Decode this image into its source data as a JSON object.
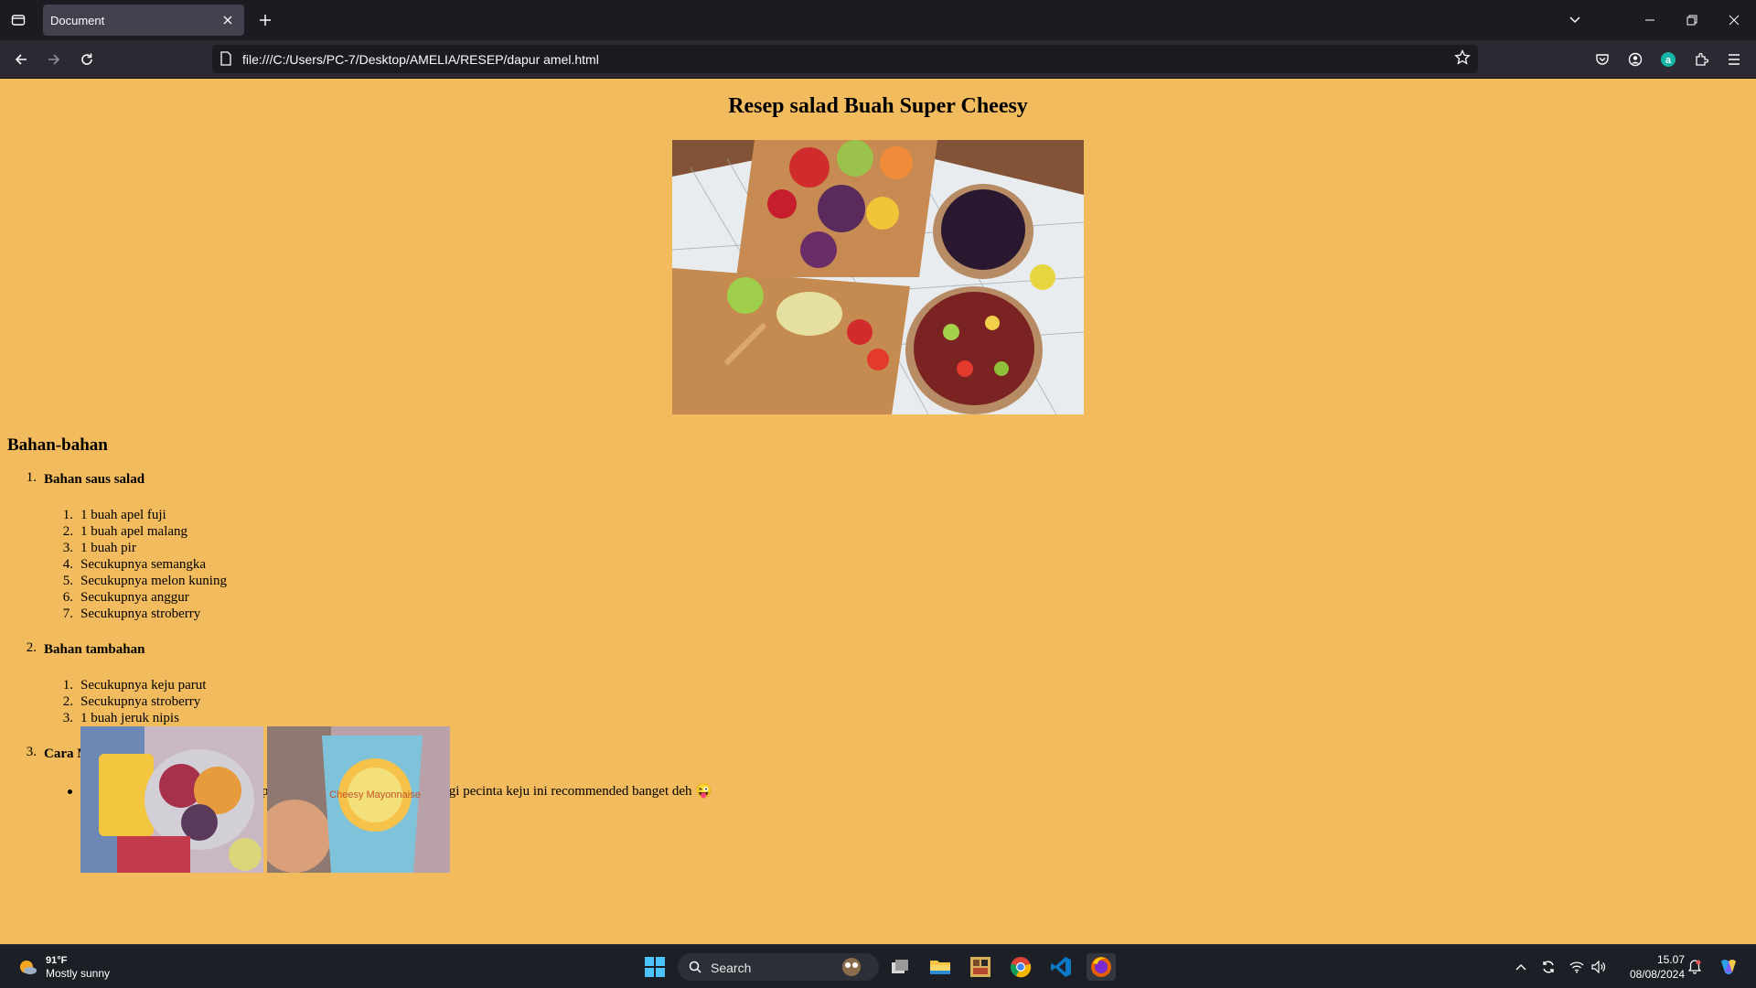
{
  "browser": {
    "tab_title": "Document",
    "url": "file:///C:/Users/PC-7/Desktop/AMELIA/RESEP/dapur amel.html"
  },
  "page": {
    "title": "Resep salad Buah Super Cheesy",
    "section_title": "Bahan-bahan",
    "groups": [
      {
        "number": "1.",
        "title": "Bahan saus salad",
        "items": [
          {
            "number": "1.",
            "text": "1 buah apel fuji"
          },
          {
            "number": "2.",
            "text": "1 buah apel malang"
          },
          {
            "number": "3.",
            "text": "1 buah pir"
          },
          {
            "number": "4.",
            "text": "Secukupnya semangka"
          },
          {
            "number": "5.",
            "text": "Secukupnya melon kuning"
          },
          {
            "number": "6.",
            "text": "Secukupnya anggur"
          },
          {
            "number": "7.",
            "text": "Secukupnya stroberry"
          }
        ]
      },
      {
        "number": "2.",
        "title": "Bahan tambahan",
        "items": [
          {
            "number": "1.",
            "text": "Secukupnya keju parut"
          },
          {
            "number": "2.",
            "text": "Secukupnya stroberry"
          },
          {
            "number": "3.",
            "text": "1 buah jeruk nipis"
          }
        ]
      },
      {
        "number": "3.",
        "title": "Cara Membuat",
        "steps": [
          {
            "text": "Siapkan semua bahan. Ini penampakan mayones cheesy nya ya. Bagi pecinta keju ini recommended banget deh 😜"
          }
        ]
      }
    ],
    "mayo_label": "Cheesy Mayonnaise"
  },
  "taskbar": {
    "weather_temp": "91°F",
    "weather_desc": "Mostly sunny",
    "search_placeholder": "Search",
    "time": "15.07",
    "date": "08/08/2024"
  },
  "colors": {
    "page_background": "#f2bb5e",
    "tab_bar": "#1c1b22",
    "nav_bar": "#2b2a33",
    "taskbar": "#1d1f27"
  }
}
